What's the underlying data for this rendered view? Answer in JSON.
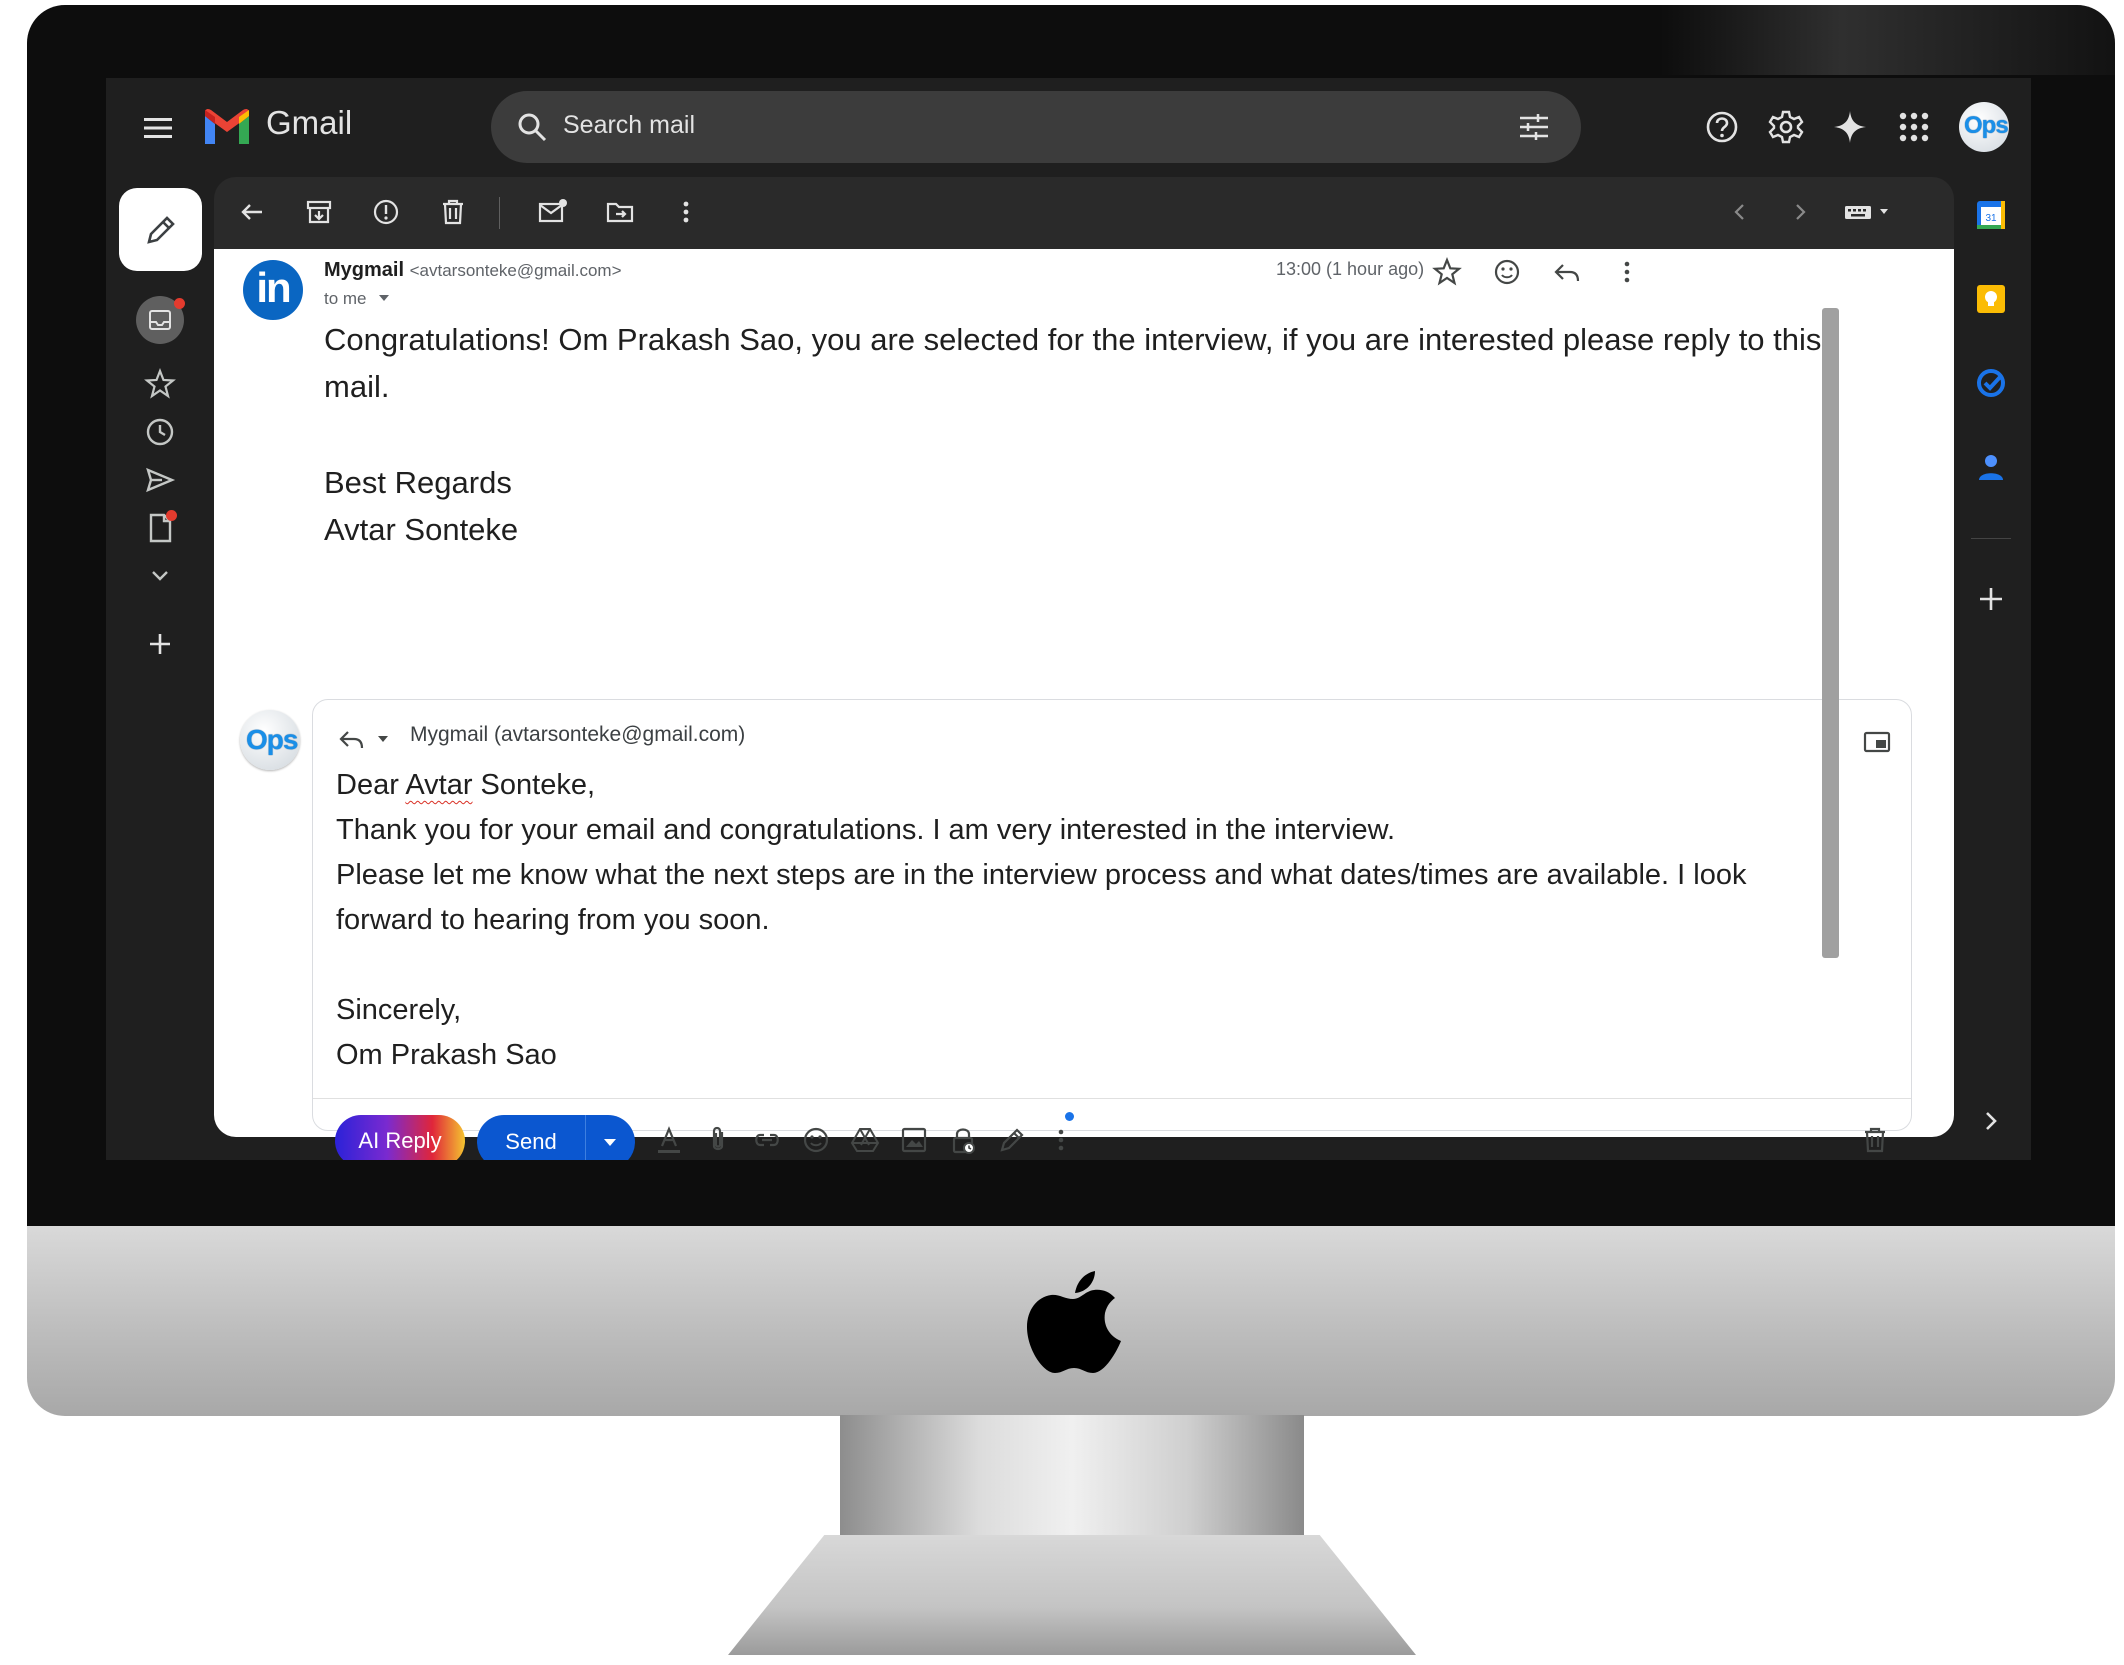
{
  "app": {
    "name": "Gmail"
  },
  "search": {
    "placeholder": "Search mail"
  },
  "header_icons": [
    "help-icon",
    "settings-icon",
    "gemini-sparkle-icon",
    "apps-grid-icon"
  ],
  "avatar": {
    "label": "Ops"
  },
  "nav_icons": [
    "inbox-icon",
    "star-icon",
    "clock-icon",
    "send-icon",
    "draft-icon",
    "chevron-down-icon",
    "plus-icon"
  ],
  "toolbar_icons": [
    "back-arrow-icon",
    "archive-icon",
    "report-spam-icon",
    "delete-icon",
    "mark-unread-icon",
    "move-to-icon",
    "more-vert-icon"
  ],
  "message": {
    "sender_name": "Mygmail",
    "sender_email": "<avtarsonteke@gmail.com>",
    "to_label": "to me",
    "timestamp": "13:00 (1 hour ago)",
    "avatar_text": "in",
    "body_line1": "Congratulations! Om Prakash Sao, you are selected for the interview, if you are interested please reply to this",
    "body_line2": "mail.",
    "regards": "Best Regards",
    "signature": "Avtar Sonteke"
  },
  "reply": {
    "to": "Mygmail (avtarsonteke@gmail.com)",
    "greeting_prefix": "Dear ",
    "greeting_misspelled": "Avtar",
    "greeting_suffix": " Sonteke,",
    "line1": "Thank you for your email and congratulations. I am very interested in the interview.",
    "line2": "Please let me know what the next steps are in the interview process and what dates/times are available. I look",
    "line3": "forward to hearing from you soon.",
    "closing": "Sincerely,",
    "name": "Om Prakash Sao",
    "ai_reply_label": "AI Reply",
    "send_label": "Send"
  },
  "colors": {
    "send_blue": "#0b57d0",
    "linkedin_blue": "#0a66c2",
    "dark_bg": "#1f1f1f"
  }
}
